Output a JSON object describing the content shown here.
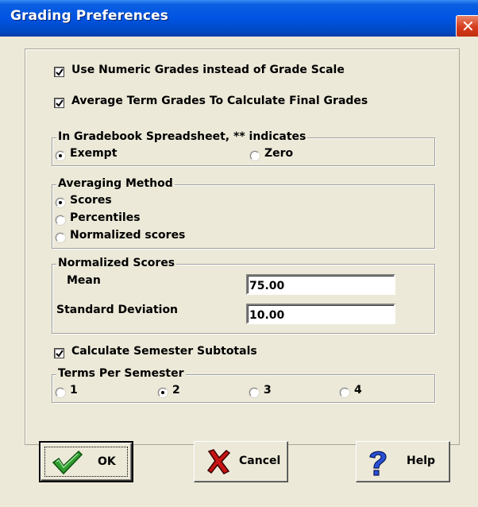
{
  "window": {
    "title": "Grading Preferences",
    "close_symbol": "✕",
    "colors": {
      "titlebar": "#0054e3",
      "face": "#ece9d8",
      "close": "#d63c1c"
    }
  },
  "options": {
    "use_numeric": {
      "label": "Use Numeric Grades instead of Grade Scale",
      "checked": true
    },
    "average_terms": {
      "label": "Average Term Grades To Calculate Final Grades",
      "checked": true
    },
    "semester_subtotals": {
      "label": "Calculate Semester Subtotals",
      "checked": true
    }
  },
  "indicator_group": {
    "legend": "In Gradebook Spreadsheet, ** indicates",
    "options": [
      {
        "label": "Exempt",
        "selected": true
      },
      {
        "label": "Zero",
        "selected": false
      }
    ]
  },
  "averaging_group": {
    "legend": "Averaging Method",
    "options": [
      {
        "label": "Scores",
        "selected": true
      },
      {
        "label": "Percentiles",
        "selected": false
      },
      {
        "label": "Normalized scores",
        "selected": false
      }
    ]
  },
  "normalized_group": {
    "legend": "Normalized Scores",
    "mean_label": "Mean",
    "mean_value": "75.00",
    "stddev_label": "Standard Deviation",
    "stddev_value": "10.00"
  },
  "terms_group": {
    "legend": "Terms Per Semester",
    "options": [
      {
        "label": "1",
        "selected": false
      },
      {
        "label": "2",
        "selected": true
      },
      {
        "label": "3",
        "selected": false
      },
      {
        "label": "4",
        "selected": false
      }
    ]
  },
  "buttons": {
    "ok": {
      "label": "OK",
      "icon": "check-icon"
    },
    "cancel": {
      "label": "Cancel",
      "icon": "x-icon"
    },
    "help": {
      "label": "Help",
      "icon": "question-icon"
    }
  },
  "background_fragment": "1"
}
